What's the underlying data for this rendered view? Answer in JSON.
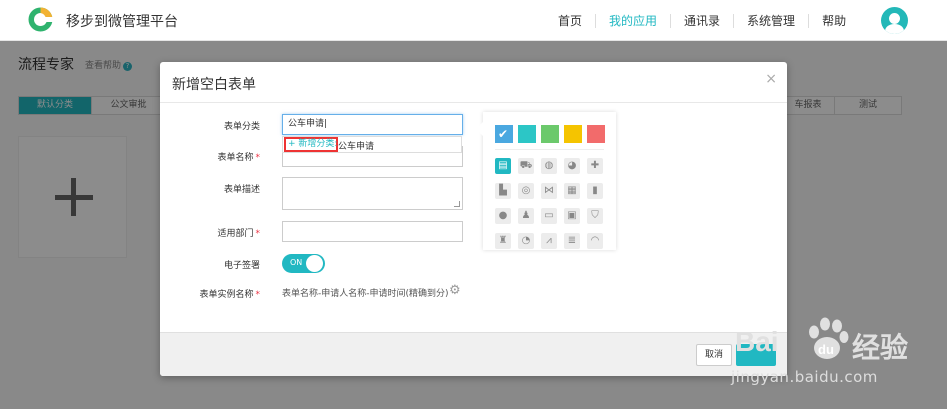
{
  "topbar": {
    "app_name": "移步到微管理平台",
    "nav": [
      "首页",
      "我的应用",
      "通讯录",
      "系统管理",
      "帮助"
    ],
    "active_nav": "我的应用"
  },
  "page": {
    "title": "流程专家",
    "help_link": "查看帮助",
    "tabs": [
      "默认分类",
      "公文审批",
      "车报表",
      "测试"
    ]
  },
  "modal": {
    "title": "新增空白表单",
    "fields": {
      "category_label": "表单分类",
      "category_value": "公车申请",
      "name_label": "表单名称",
      "description_label": "表单描述",
      "department_label": "适用部门",
      "signature_label": "电子签署",
      "instance_name_label": "表单实例名称"
    },
    "dropdown": {
      "new_category_label": "+ 新增分类:",
      "value": "公车申请"
    },
    "toggle_label": "ON",
    "instance_name_value": "表单名称-申请人名称-申请时间(精确到分)",
    "cancel_label": "取消",
    "close_symbol": "×"
  },
  "picker": {
    "colors": [
      "#4aa8e0",
      "#2cc6c6",
      "#6cc96c",
      "#f5c400",
      "#f26b6b"
    ],
    "selected_color": "#4aa8e0",
    "icons": [
      [
        "clipboard-icon",
        "truck-icon",
        "globe-icon",
        "chart-pie-icon",
        "medical-kit-icon"
      ],
      [
        "building-icon",
        "world-icon",
        "sitemap-icon",
        "calculator-icon",
        "book-icon"
      ],
      [
        "user-icon",
        "people-icon",
        "credit-card-icon",
        "money-icon",
        "cart-icon"
      ],
      [
        "stamp-icon",
        "pie-chart-icon",
        "line-chart-icon",
        "stack-icon",
        "gauge-icon"
      ]
    ]
  },
  "watermark": {
    "brand": "Bai",
    "brand_cn": "经验",
    "url": "jingyan.baidu.com"
  }
}
